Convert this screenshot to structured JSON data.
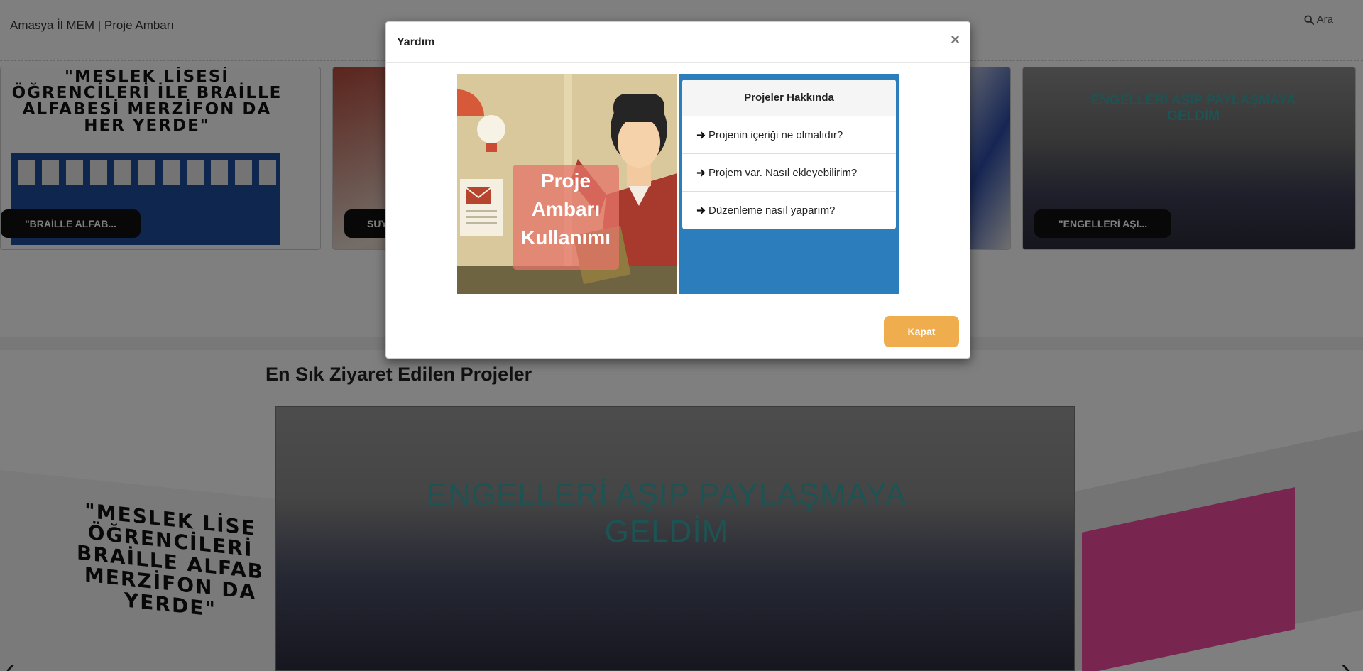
{
  "topnav": {
    "brand": "Amasya İl MEM | Proje Ambarı",
    "search_label": "Ara"
  },
  "strip": {
    "cards": [
      {
        "caption": "\"BRAİLLE ALFAB...",
        "poster_text": "\"MESLEK LİSESİ ÖĞRENCİLERİ İLE BRAİLLE ALFABESİ MERZİFON DA HER YERDE\""
      },
      {
        "caption": "SUY"
      },
      {
        "caption": "\"ENGELLERİ AŞI...",
        "overlay_text": "ENGELLERİ AŞIP PAYLAŞMAYA GELDİM"
      }
    ]
  },
  "section": {
    "title": "En Sık Ziyaret Edilen Projeler"
  },
  "carousel": {
    "center_text": "ENGELLERİ AŞIP PAYLAŞMAYA GELDİM",
    "left_text": "\"MESLEK LİSE ÖĞRENCİLERİ BRAİLLE ALFAB MERZİFON DA YERDE\""
  },
  "modal": {
    "title": "Yardım",
    "close_symbol": "×",
    "illustration_text": [
      "Proje",
      "Ambarı",
      "Kullanımı"
    ],
    "panel": {
      "heading": "Projeler Hakkında",
      "items": [
        "Projenin içeriği ne olmalıdır?",
        "Projem var. Nasıl ekleyebilirim?",
        "Düzenleme nasıl yaparım?"
      ]
    },
    "footer_button": "Kapat"
  },
  "colors": {
    "panel_blue": "#2b7dbc",
    "button_orange": "#f0ad4e",
    "overlay_teal": "#3aa6a6"
  },
  "icons": [
    "search-icon",
    "arrow-right-icon",
    "close-icon",
    "chevron-left-icon",
    "chevron-right-icon"
  ]
}
